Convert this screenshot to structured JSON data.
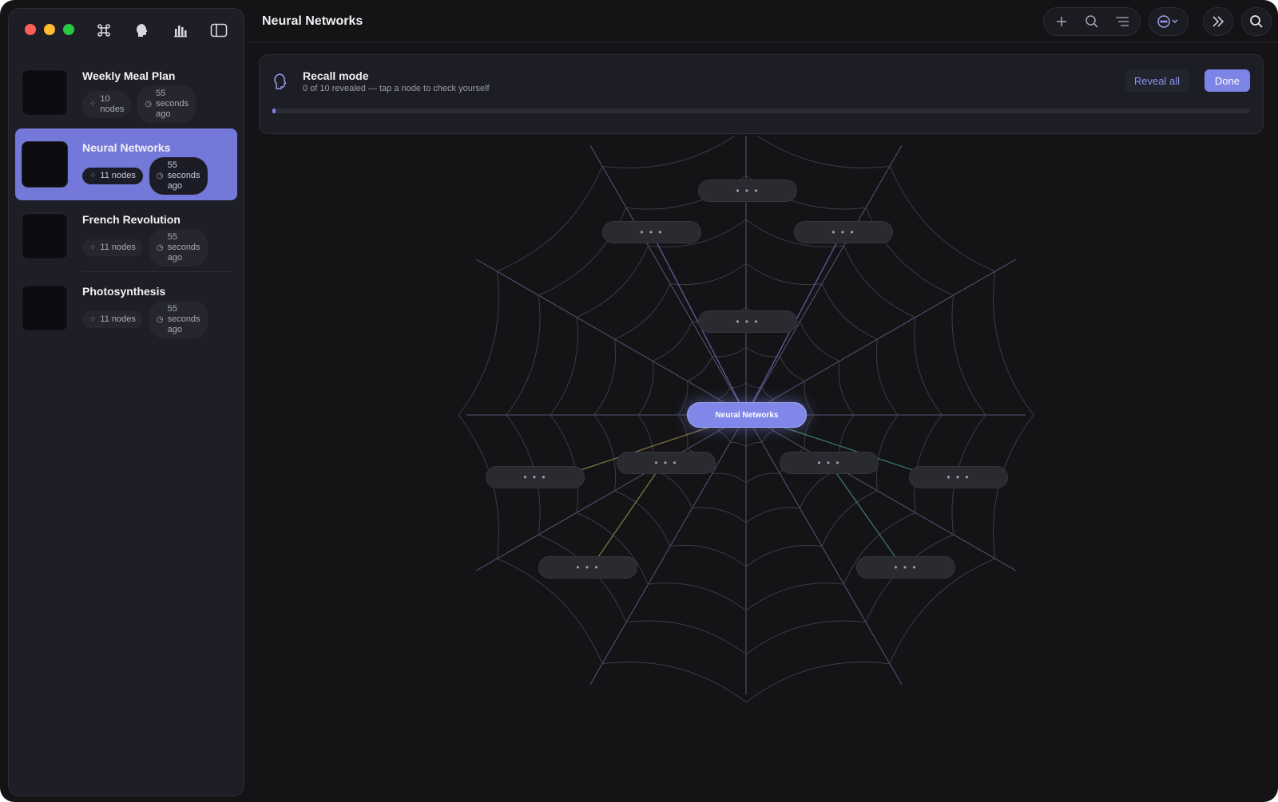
{
  "app": {
    "page_title": "Neural Networks"
  },
  "sidebar": {
    "maps": [
      {
        "title": "Weekly Meal Plan",
        "nodes_a": "10",
        "nodes_b": "nodes",
        "time_a": "55",
        "time_b": "seconds",
        "time_c": "ago"
      },
      {
        "title": "Neural Networks",
        "nodes": "11 nodes",
        "time_a": "55",
        "time_b": "seconds",
        "time_c": "ago"
      },
      {
        "title": "French Revolution",
        "nodes": "11 nodes",
        "time_a": "55",
        "time_b": "seconds",
        "time_c": "ago"
      },
      {
        "title": "Photosynthesis",
        "nodes": "11 nodes",
        "time_a": "55",
        "time_b": "seconds",
        "time_c": "ago"
      }
    ],
    "active_index": 1
  },
  "recall": {
    "title": "Recall mode",
    "subtitle": "0 of 10 revealed — tap a node to check yourself",
    "reveal_label": "Reveal all",
    "done_label": "Done",
    "revealed": 0,
    "total": 10
  },
  "graph": {
    "center_label": "Neural Networks",
    "hidden_label": "• • •",
    "edge_colors": {
      "default": "#55567a",
      "amber": "#8a7a45",
      "teal": "#3f7a72",
      "violet": "#6a5fa8"
    }
  },
  "colors": {
    "accent": "#7d84e6",
    "background": "#141417",
    "sidebar": "#1e1f26"
  }
}
